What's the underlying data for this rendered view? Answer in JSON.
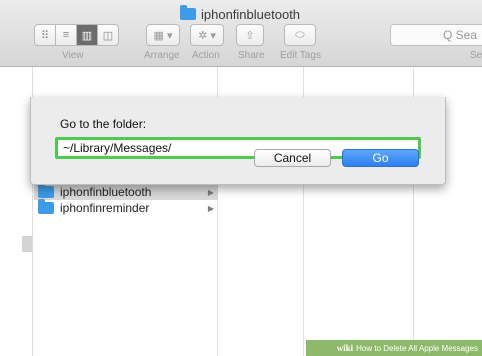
{
  "window": {
    "title": "iphonfinbluetooth"
  },
  "toolbar": {
    "view_label": "View",
    "arrange_label": "Arrange",
    "action_label": "Action",
    "share_label": "Share",
    "edit_tags_label": "Edit Tags",
    "search_placeholder": "Q Sea",
    "search_label": "Se"
  },
  "finder": {
    "items": [
      {
        "name": "iphonfinbluetooth",
        "selected": true
      },
      {
        "name": "iphonfinreminder",
        "selected": false
      }
    ]
  },
  "dialog": {
    "label": "Go to the folder:",
    "path_value": "~/Library/Messages/",
    "cancel_label": "Cancel",
    "go_label": "Go"
  },
  "watermark": {
    "brand": "wiki",
    "text": "How to Delete All Apple Messages"
  },
  "colors": {
    "accent": "#2d7ff0",
    "highlight": "#4fc94f",
    "folder": "#3e9be8"
  }
}
